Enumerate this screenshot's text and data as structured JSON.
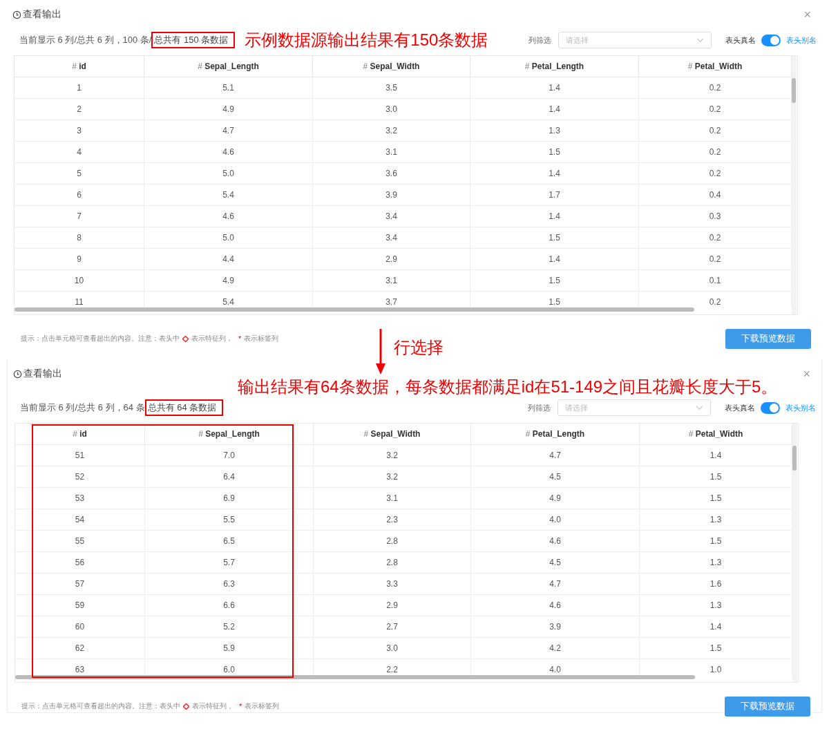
{
  "panels": [
    {
      "title": "查看输出",
      "close": "×",
      "summary": "当前显示 6 列/总共 6 列，100 条/",
      "summary_boxed": "总共有 150 条数据",
      "note": {
        "kind": "inline",
        "text": "示例数据源输出结果有150条数据"
      },
      "filter_label": "列筛选",
      "filter": {
        "placeholder": "请选择"
      },
      "switch_label": "表头真名",
      "switch": {
        "on": true
      },
      "switch_alt": "表头别名",
      "columns": [
        {
          "mark": "#",
          "name": "id",
          "highlighted": false
        },
        {
          "mark": "#",
          "name": "Sepal_Length",
          "highlighted": false
        },
        {
          "mark": "#",
          "name": "Sepal_Width",
          "highlighted": false
        },
        {
          "mark": "#",
          "name": "Petal_Length",
          "highlighted": false
        },
        {
          "mark": "#",
          "name": "Petal_Width",
          "highlighted": false
        }
      ],
      "rows": [
        [
          "1",
          "5.1",
          "3.5",
          "1.4",
          "0.2"
        ],
        [
          "2",
          "4.9",
          "3.0",
          "1.4",
          "0.2"
        ],
        [
          "3",
          "4.7",
          "3.2",
          "1.3",
          "0.2"
        ],
        [
          "4",
          "4.6",
          "3.1",
          "1.5",
          "0.2"
        ],
        [
          "5",
          "5.0",
          "3.6",
          "1.4",
          "0.2"
        ],
        [
          "6",
          "5.4",
          "3.9",
          "1.7",
          "0.4"
        ],
        [
          "7",
          "4.6",
          "3.4",
          "1.4",
          "0.3"
        ],
        [
          "8",
          "5.0",
          "3.4",
          "1.5",
          "0.2"
        ],
        [
          "9",
          "4.4",
          "2.9",
          "1.4",
          "0.2"
        ],
        [
          "10",
          "4.9",
          "3.1",
          "1.5",
          "0.1"
        ],
        [
          "11",
          "5.4",
          "3.7",
          "1.5",
          "0.2"
        ]
      ],
      "hint": {
        "lead": "提示：点击单元格可查看超出的内容。注意：表头中",
        "feature": "表示特征列，",
        "star": "*",
        "label": "表示标签列"
      },
      "button": "下载预览数据"
    },
    {
      "title": "查看输出",
      "close": "×",
      "summary": "当前显示 6 列/总共 6 列，64 条",
      "summary_boxed": "总共有 64 条数据",
      "note": {
        "kind": "overlay",
        "text": "输出结果有64条数据，每条数据都满足id在51-149之间且花瓣长度大于5。"
      },
      "filter_label": "列筛选",
      "filter": {
        "placeholder": "请选择"
      },
      "switch_label": "表头真名",
      "switch": {
        "on": true
      },
      "switch_alt": "表头别名",
      "columns": [
        {
          "mark": "#",
          "name": "id",
          "highlighted": true
        },
        {
          "mark": "#",
          "name": "Sepal_Length",
          "highlighted": true
        },
        {
          "mark": "#",
          "name": "Sepal_Width",
          "highlighted": false
        },
        {
          "mark": "#",
          "name": "Petal_Length",
          "highlighted": false
        },
        {
          "mark": "#",
          "name": "Petal_Width",
          "highlighted": false
        }
      ],
      "rows": [
        [
          "51",
          "7.0",
          "3.2",
          "4.7",
          "1.4"
        ],
        [
          "52",
          "6.4",
          "3.2",
          "4.5",
          "1.5"
        ],
        [
          "53",
          "6.9",
          "3.1",
          "4.9",
          "1.5"
        ],
        [
          "54",
          "5.5",
          "2.3",
          "4.0",
          "1.3"
        ],
        [
          "55",
          "6.5",
          "2.8",
          "4.6",
          "1.5"
        ],
        [
          "56",
          "5.7",
          "2.8",
          "4.5",
          "1.3"
        ],
        [
          "57",
          "6.3",
          "3.3",
          "4.7",
          "1.6"
        ],
        [
          "59",
          "6.6",
          "2.9",
          "4.6",
          "1.3"
        ],
        [
          "60",
          "5.2",
          "2.7",
          "3.9",
          "1.4"
        ],
        [
          "62",
          "5.9",
          "3.0",
          "4.2",
          "1.5"
        ],
        [
          "63",
          "6.0",
          "2.2",
          "4.0",
          "1.0"
        ]
      ],
      "hint": {
        "lead": "提示：点击单元格可查看超出的内容。注意：表头中",
        "feature": "表示特征列，",
        "star": "*",
        "label": "表示标签列"
      },
      "button": "下载预览数据"
    }
  ],
  "connector": {
    "label": "行选择"
  }
}
